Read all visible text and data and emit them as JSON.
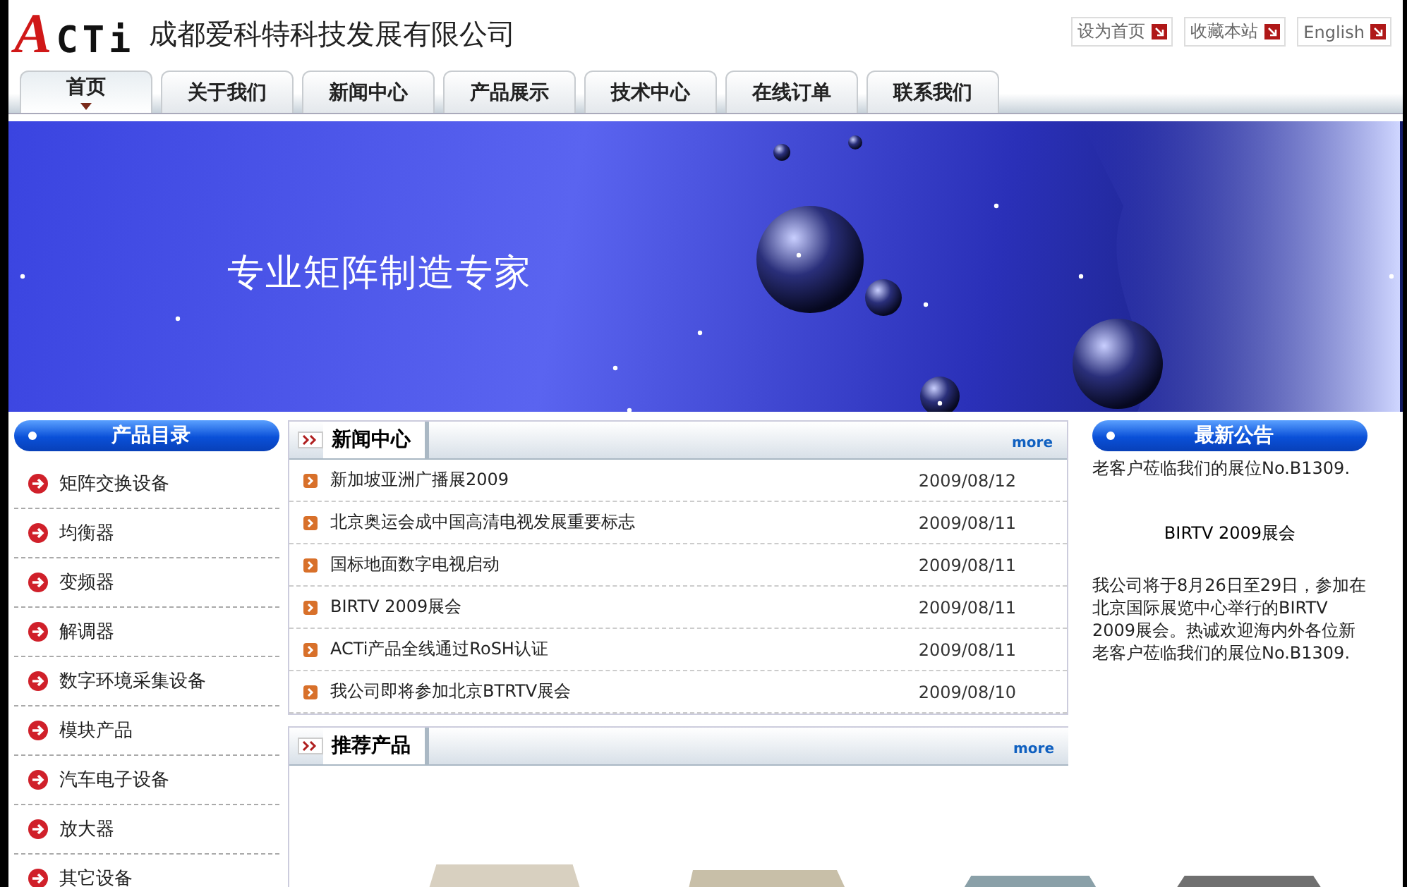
{
  "header": {
    "logo": "ACTi",
    "company": "成都爱科特科技发展有限公司",
    "links": [
      {
        "label": "设为首页"
      },
      {
        "label": "收藏本站"
      },
      {
        "label": "English"
      }
    ]
  },
  "nav": [
    {
      "label": "首页",
      "selected": true
    },
    {
      "label": "关于我们",
      "selected": false
    },
    {
      "label": "新闻中心",
      "selected": false
    },
    {
      "label": "产品展示",
      "selected": false
    },
    {
      "label": "技术中心",
      "selected": false
    },
    {
      "label": "在线订单",
      "selected": false
    },
    {
      "label": "联系我们",
      "selected": false
    }
  ],
  "banner": {
    "slogan": "专业矩阵制造专家"
  },
  "sidebar": {
    "title": "产品目录",
    "items": [
      "矩阵交换设备",
      "均衡器",
      "变频器",
      "解调器",
      "数字环境采集设备",
      "模块产品",
      "汽车电子设备",
      "放大器",
      "其它设备"
    ]
  },
  "news": {
    "title": "新闻中心",
    "more": "more",
    "items": [
      {
        "title": "新加坡亚洲广播展2009",
        "date": "2009/08/12"
      },
      {
        "title": "北京奥运会成中国高清电视发展重要标志",
        "date": "2009/08/11"
      },
      {
        "title": "国标地面数字电视启动",
        "date": "2009/08/11"
      },
      {
        "title": "BIRTV 2009展会",
        "date": "2009/08/11"
      },
      {
        "title": "ACTi产品全线通过RoSH认证",
        "date": "2009/08/11"
      },
      {
        "title": "我公司即将参加北京BTRTV展会",
        "date": "2009/08/10"
      }
    ]
  },
  "products": {
    "title": "推荐产品",
    "more": "more"
  },
  "notice": {
    "title": "最新公告",
    "tail": "老客户莅临我们的展位No.B1309.",
    "heading": "BIRTV 2009展会",
    "body": "我公司将于8月26日至29日，参加在北京国际展览中心举行的BIRTV 2009展会。热诚欢迎海内外各位新老客户莅临我们的展位No.B1309."
  }
}
